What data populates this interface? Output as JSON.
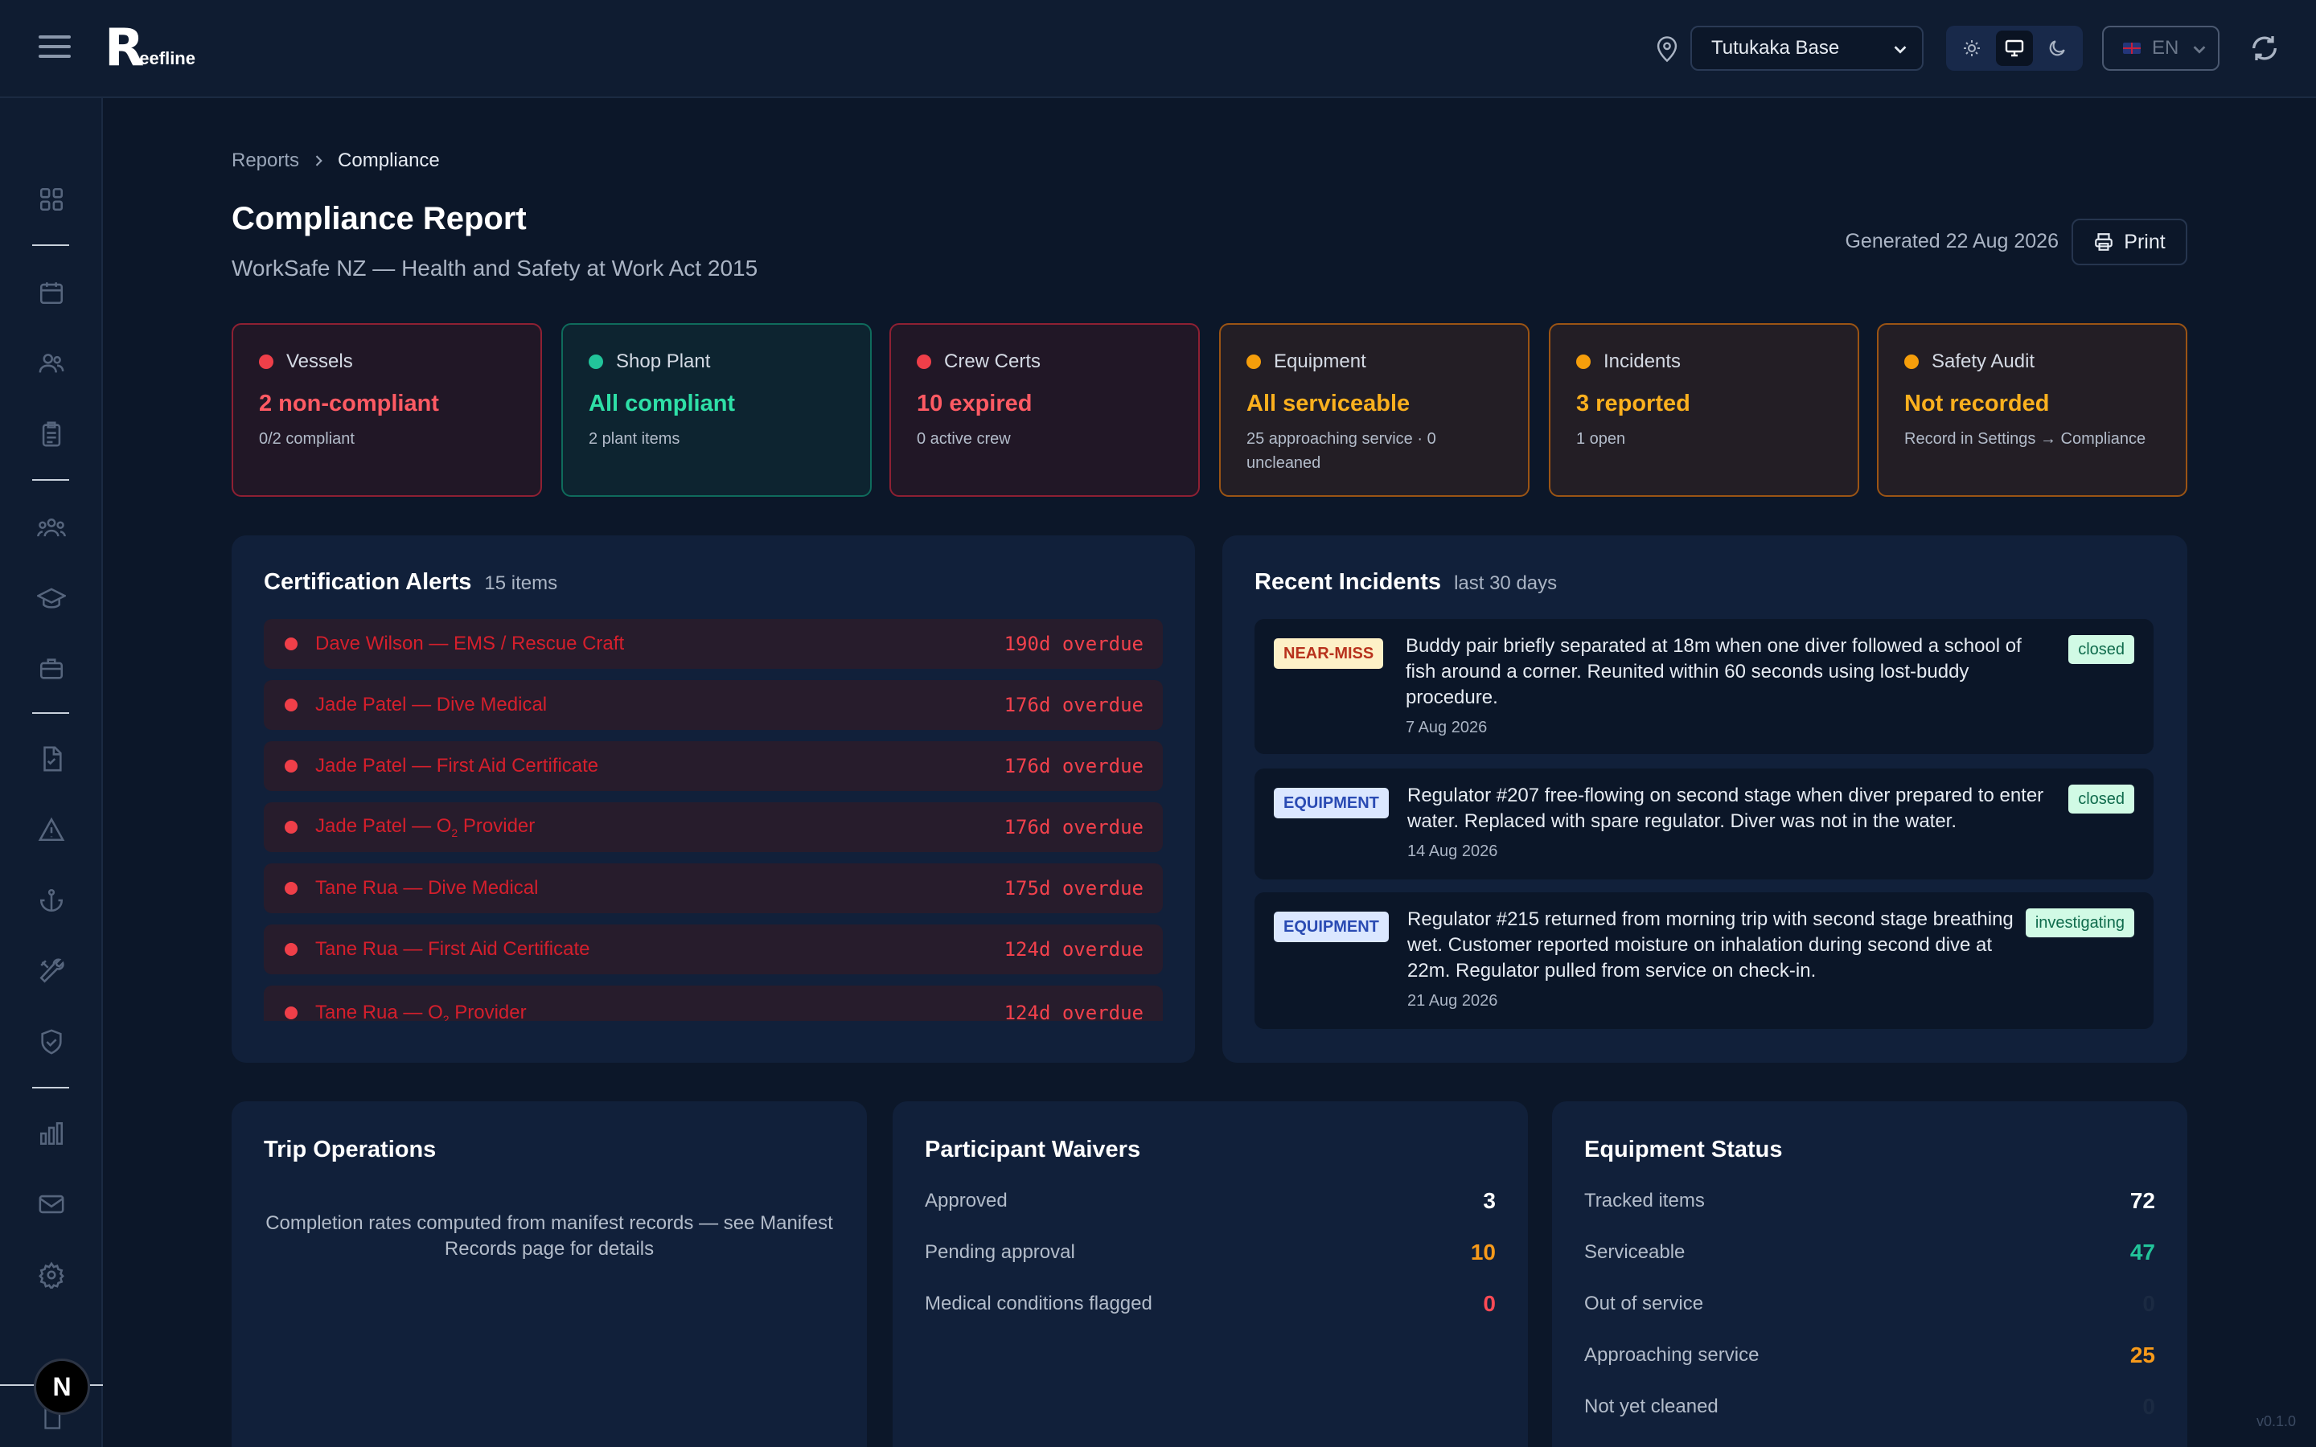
{
  "app": {
    "logo_letter": "R",
    "logo_text": "eefline",
    "base_select": "Tutukaka Base",
    "lang": "EN",
    "version": "v0.1.0",
    "dev_badge": "N"
  },
  "breadcrumb": {
    "parent": "Reports",
    "current": "Compliance"
  },
  "header": {
    "title": "Compliance Report",
    "subtitle": "WorkSafe NZ — Health and Safety at Work Act 2015",
    "generated": "Generated 22 Aug 2026",
    "print_label": "Print"
  },
  "status_cards": [
    {
      "label": "Vessels",
      "value": "2 non-compliant",
      "note": "0/2 compliant",
      "tone": "red"
    },
    {
      "label": "Shop Plant",
      "value": "All compliant",
      "note": "2 plant items",
      "tone": "green"
    },
    {
      "label": "Crew Certs",
      "value": "10 expired",
      "note": "0 active crew",
      "tone": "red"
    },
    {
      "label": "Equipment",
      "value": "All serviceable",
      "note": "25 approaching service · 0 uncleaned",
      "tone": "amber"
    },
    {
      "label": "Incidents",
      "value": "3 reported",
      "note": "1 open",
      "tone": "amber"
    },
    {
      "label": "Safety Audit",
      "value": "Not recorded",
      "note": "Record in Settings → Compliance",
      "tone": "amber"
    }
  ],
  "cert_alerts": {
    "title": "Certification Alerts",
    "count": "15 items",
    "items": [
      {
        "name": "Dave Wilson — EMS / Rescue Craft",
        "overdue": "190d overdue"
      },
      {
        "name": "Jade Patel — Dive Medical",
        "overdue": "176d overdue"
      },
      {
        "name": "Jade Patel — First Aid Certificate",
        "overdue": "176d overdue"
      },
      {
        "name_prefix": "Jade Patel — O",
        "name_sub": "2",
        "name_suffix": " Provider",
        "overdue": "176d overdue"
      },
      {
        "name": "Tane Rua — Dive Medical",
        "overdue": "175d overdue"
      },
      {
        "name": "Tane Rua — First Aid Certificate",
        "overdue": "124d overdue"
      },
      {
        "name_prefix": "Tane Rua — O",
        "name_sub": "2",
        "name_suffix": " Provider",
        "overdue": "124d overdue"
      }
    ]
  },
  "incidents": {
    "title": "Recent Incidents",
    "range": "last 30 days",
    "items": [
      {
        "tag": "NEAR-MISS",
        "text": "Buddy pair briefly separated at 18m when one diver followed a school of fish around a corner. Reunited within 60 seconds using lost-buddy procedure.",
        "date": "7 Aug 2026",
        "status": "closed"
      },
      {
        "tag": "EQUIPMENT",
        "text": "Regulator #207 free-flowing on second stage when diver prepared to enter water. Replaced with spare regulator. Diver was not in the water.",
        "date": "14 Aug 2026",
        "status": "closed"
      },
      {
        "tag": "EQUIPMENT",
        "text": "Regulator #215 returned from morning trip with second stage breathing wet. Customer reported moisture on inhalation during second dive at 22m. Regulator pulled from service on check-in.",
        "date": "21 Aug 2026",
        "status": "investigating"
      }
    ]
  },
  "trip_ops": {
    "title": "Trip Operations",
    "note": "Completion rates computed from manifest records — see Manifest Records page for details"
  },
  "waivers": {
    "title": "Participant Waivers",
    "rows": [
      {
        "label": "Approved",
        "value": "3"
      },
      {
        "label": "Pending approval",
        "value": "10"
      },
      {
        "label": "Medical conditions flagged",
        "value": "0"
      }
    ]
  },
  "equipment_status": {
    "title": "Equipment Status",
    "rows": [
      {
        "label": "Tracked items",
        "value": "72"
      },
      {
        "label": "Serviceable",
        "value": "47"
      },
      {
        "label": "Out of service",
        "value": "0"
      },
      {
        "label": "Approaching service",
        "value": "25"
      },
      {
        "label": "Not yet cleaned",
        "value": "0"
      }
    ]
  },
  "colors": {
    "background": "#0c1729",
    "panel": "#11203a",
    "danger": "#ef3f49",
    "success": "#22c49a",
    "warning": "#f59e0b"
  },
  "icons": {
    "sidebar": [
      "dashboard-icon",
      "calendar-icon",
      "customers-icon",
      "clipboard-icon",
      "crew-icon",
      "courses-icon",
      "briefcase-icon",
      "document-check-icon",
      "warning-icon",
      "anchor-icon",
      "tools-icon",
      "shield-icon",
      "chart-icon",
      "mail-icon",
      "settings-icon",
      "file-icon"
    ]
  }
}
